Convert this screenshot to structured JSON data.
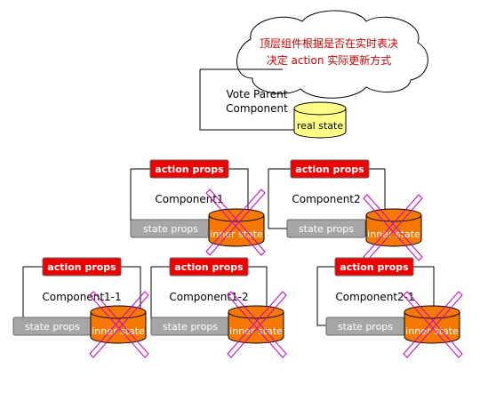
{
  "colors": {
    "action": "#ee0000",
    "state_props": "#a6a6a6",
    "inner_state": "#f57900",
    "real_state": "#ffff88",
    "cross": "#cc00cc",
    "note_text": "#cc0000"
  },
  "cloud_note": {
    "line1": "顶层组件根据是否在实时表决",
    "line2": "决定 action 实际更新方式"
  },
  "parent": {
    "line1": "Vote Parent",
    "line2": "Component",
    "real_state": "real state"
  },
  "components": {
    "c1": {
      "name": "Component1",
      "action": "action props",
      "state": "state props",
      "inner": "inner state"
    },
    "c2": {
      "name": "Component2",
      "action": "action props",
      "state": "state props",
      "inner": "inner state"
    },
    "c11": {
      "name": "Component1-1",
      "action": "action props",
      "state": "state props",
      "inner": "inner state"
    },
    "c12": {
      "name": "Component1-2",
      "action": "action props",
      "state": "state props",
      "inner": "inner state"
    },
    "c21": {
      "name": "Component2-1",
      "action": "action props",
      "state": "state props",
      "inner": "inner state"
    }
  }
}
